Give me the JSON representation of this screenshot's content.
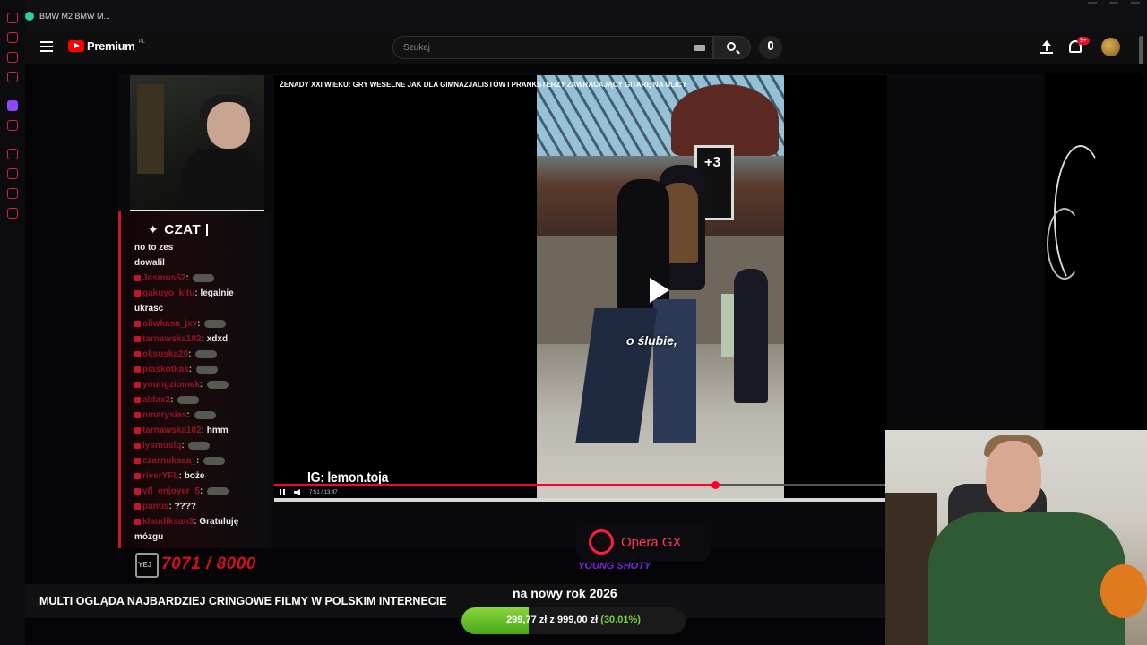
{
  "browser": {
    "tab_title": "BMW M2 BMW M..."
  },
  "header": {
    "logo_text": "Premium",
    "logo_country": "PL",
    "search_placeholder": "Szukaj",
    "notification_count": "9+"
  },
  "stream": {
    "chat": {
      "title": "CZAT",
      "messages": [
        {
          "user": "",
          "text": "no to zes"
        },
        {
          "user": "",
          "text": "dowalil"
        },
        {
          "user": "Jasmus52",
          "text": ""
        },
        {
          "user": "gakuyo_kjtu",
          "text": "legalnie"
        },
        {
          "user": "",
          "text": "ukrasc"
        },
        {
          "user": "oliwkasa_jxv",
          "text": ""
        },
        {
          "user": "tarnawska102",
          "text": "xdxd"
        },
        {
          "user": "oksuska20",
          "text": ""
        },
        {
          "user": "piaskotkas",
          "text": ""
        },
        {
          "user": "youngziomek",
          "text": ""
        },
        {
          "user": "aldax2",
          "text": ""
        },
        {
          "user": "nmarysias",
          "text": ""
        },
        {
          "user": "tarnawska102",
          "text": "hmm"
        },
        {
          "user": "lysmuslq",
          "text": ""
        },
        {
          "user": "czarnuksaa_",
          "text": ""
        },
        {
          "user": "riverYFL",
          "text": "boże"
        },
        {
          "user": "yfl_enjoyer_5",
          "text": ""
        },
        {
          "user": "pantis",
          "text": "????"
        },
        {
          "user": "klaudiksan3",
          "text": "Gratuluję"
        },
        {
          "user": "",
          "text": "mózgu"
        }
      ]
    },
    "video": {
      "title": "ŻENADY XXI WIEKU: GRY WESELNE JAK DLA GIMNAZJALISTÓW I PRANKSTERZY ZAWRACAJĄCY GITARĘ NA ULICY",
      "screen_sign": "+3",
      "subtitle": "o ślubie,",
      "watermark": "IG: lemon.toja",
      "progress": 0.72,
      "time": "7:51 / 13:47"
    },
    "counter": "7071 / 8000",
    "sponsor": "Opera GX",
    "sponsor_sub": "YOUNG SHOTY",
    "stream_title": "MULTI OGLĄDA NAJBARDZIEJ CRINGOWE FILMY W POLSKIM INTERNECIE",
    "goal": {
      "title": "na nowy rok 2026",
      "current": "299,77 zł",
      "separator": "z",
      "target": "999,00 zł",
      "percent_label": "(30.01%)",
      "fraction": 0.3001
    }
  },
  "colors": {
    "accent_red": "#c8162c",
    "goal_green": "#7bd43a",
    "youtube_red": "#ff0000"
  },
  "icons": [
    "menu-icon",
    "youtube-logo-icon",
    "search-icon",
    "mic-icon",
    "upload-icon",
    "bell-icon",
    "play-icon"
  ]
}
